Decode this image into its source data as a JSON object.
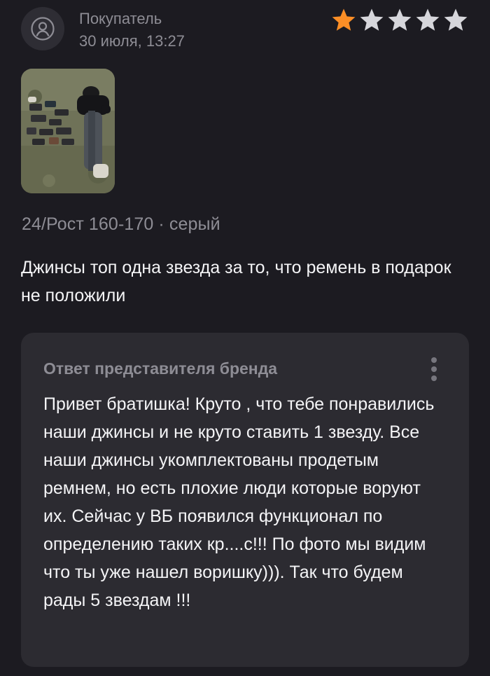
{
  "review": {
    "author": "Покупатель",
    "date": "30 июля, 13:27",
    "rating": 1,
    "rating_max": 5,
    "star_colors": {
      "filled": "#fb8e26",
      "empty": "#d6d6db"
    },
    "avatar_icon": "user-icon",
    "photo": {
      "alt": "фото отзыва"
    },
    "variant": "24/Рост 160-170 · серый",
    "text": "Джинсы топ одна звезда за то, что ремень в подарок не положили"
  },
  "reply": {
    "title": "Ответ представителя бренда",
    "menu_icon": "more-vertical-icon",
    "text": "Привет братишка! Круто , что тебе понравились наши джинсы и не круто ставить 1 звезду. Все наши джинсы укомплектованы продетым ремнем, но есть плохие люди которые воруют их. Сейчас у ВБ появился функционал по определению таких кр....с!!! По фото мы видим что ты уже нашел воришку))). Так что будем рады 5 звездам !!!"
  }
}
